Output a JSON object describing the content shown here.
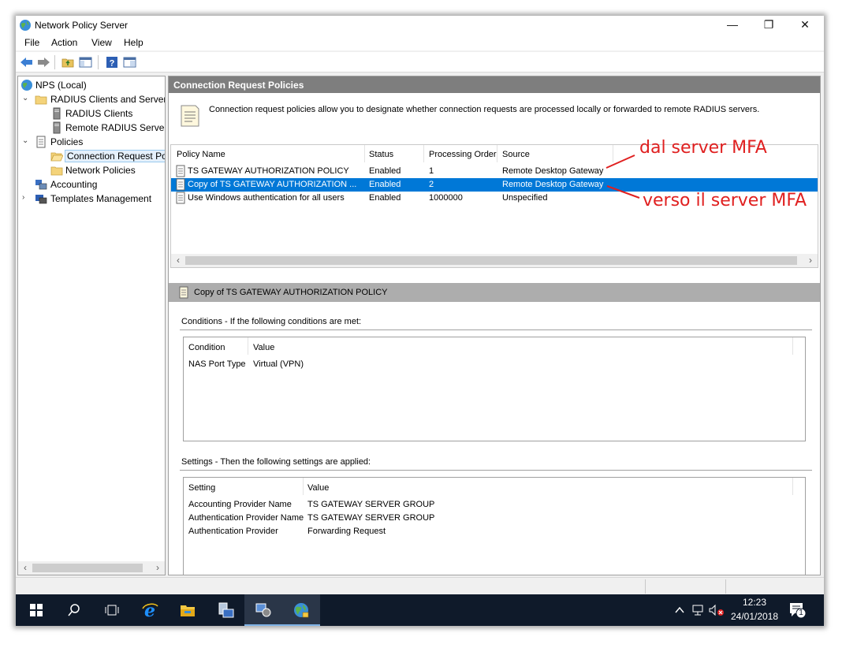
{
  "window": {
    "title": "Network Policy Server",
    "controls": {
      "minimize": "—",
      "restore": "❐",
      "close": "✕"
    }
  },
  "menu": [
    "File",
    "Action",
    "View",
    "Help"
  ],
  "tree": {
    "items": [
      {
        "label": "NPS (Local)",
        "icon": "nps-globe-icon"
      },
      {
        "label": "RADIUS Clients and Servers",
        "icon": "folder-icon",
        "expanded": true
      },
      {
        "label": "RADIUS Clients",
        "icon": "server-icon"
      },
      {
        "label": "Remote RADIUS Server",
        "icon": "server-icon"
      },
      {
        "label": "Policies",
        "icon": "policy-doc-icon",
        "expanded": true
      },
      {
        "label": "Connection Request Po",
        "icon": "open-folder-icon",
        "selected": true
      },
      {
        "label": "Network Policies",
        "icon": "folder-icon"
      },
      {
        "label": "Accounting",
        "icon": "accounting-icon"
      },
      {
        "label": "Templates Management",
        "icon": "templates-icon",
        "expanded": false
      }
    ]
  },
  "main": {
    "header": "Connection Request Policies",
    "description": "Connection request policies allow you to designate whether connection requests are processed locally or forwarded to remote RADIUS servers.",
    "columns": [
      "Policy Name",
      "Status",
      "Processing Order",
      "Source"
    ],
    "rows": [
      {
        "name": "TS GATEWAY AUTHORIZATION POLICY",
        "status": "Enabled",
        "order": "1",
        "source": "Remote Desktop Gateway"
      },
      {
        "name": "Copy of TS GATEWAY AUTHORIZATION ...",
        "status": "Enabled",
        "order": "2",
        "source": "Remote Desktop Gateway",
        "selected": true
      },
      {
        "name": "Use Windows authentication for all users",
        "status": "Enabled",
        "order": "1000000",
        "source": "Unspecified"
      }
    ],
    "detail_header": "Copy of TS GATEWAY AUTHORIZATION POLICY",
    "conditions": {
      "label": "Conditions - If the following conditions are met:",
      "columns": [
        "Condition",
        "Value"
      ],
      "rows": [
        {
          "condition": "NAS Port Type",
          "value": "Virtual (VPN)"
        }
      ]
    },
    "settings": {
      "label": "Settings - Then the following settings are applied:",
      "columns": [
        "Setting",
        "Value"
      ],
      "rows": [
        {
          "setting": "Accounting Provider Name",
          "value": "TS GATEWAY SERVER GROUP"
        },
        {
          "setting": "Authentication Provider Name",
          "value": "TS GATEWAY SERVER GROUP"
        },
        {
          "setting": "Authentication Provider",
          "value": "Forwarding Request"
        }
      ]
    }
  },
  "annotations": {
    "top": "dal server MFA",
    "bottom": "verso il server MFA",
    "color": "#e02020"
  },
  "taskbar": {
    "time": "12:23",
    "date": "24/01/2018",
    "notification_count": "1"
  }
}
